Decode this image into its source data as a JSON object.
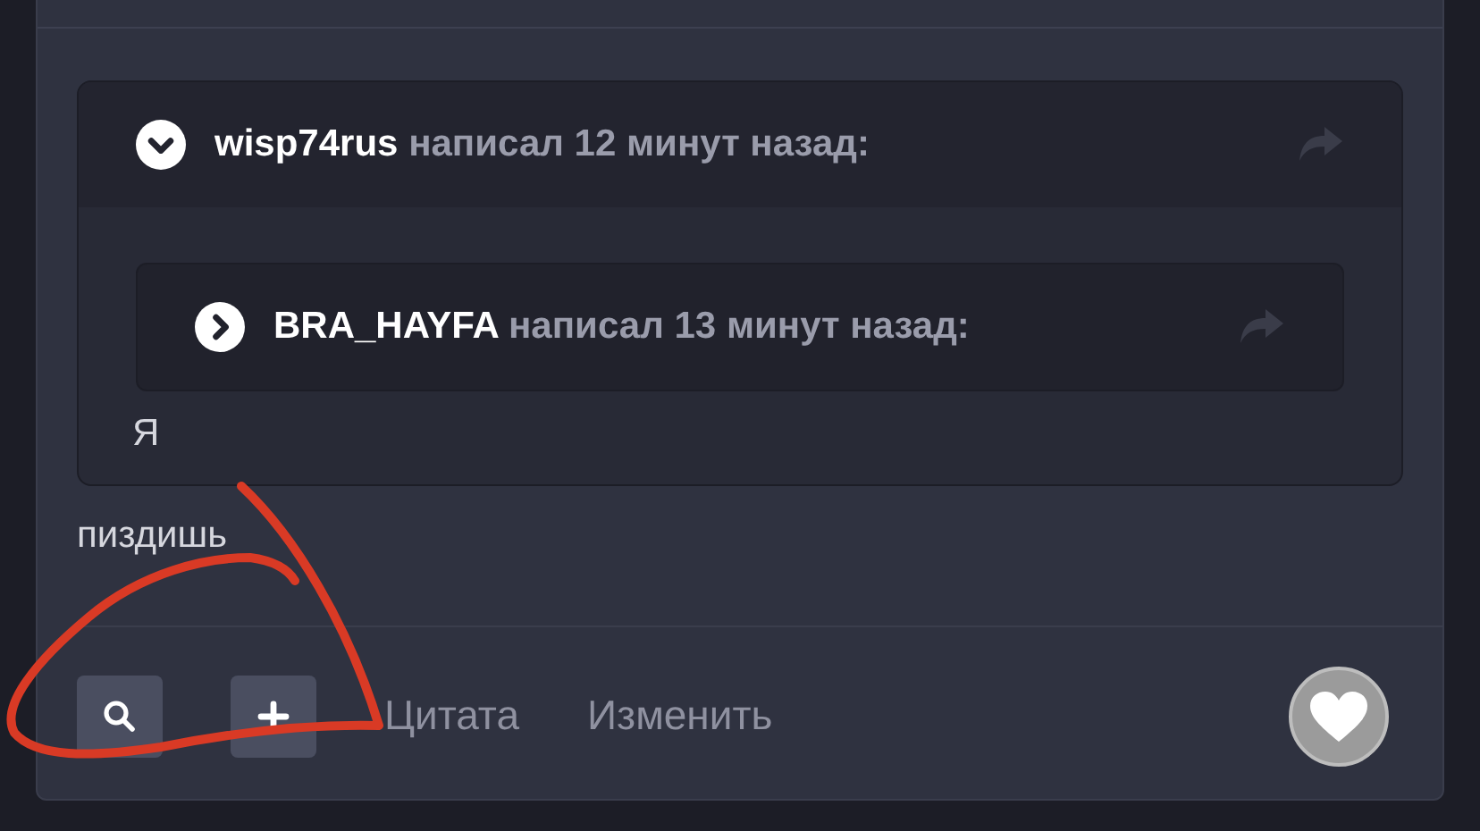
{
  "quote": {
    "author": "wisp74rus",
    "meta": "написал 12 минут назад:",
    "expanded": true,
    "nested": {
      "author": "BRA_HAYFA",
      "meta": "написал 13 минут назад:",
      "expanded": false
    },
    "body": "Я"
  },
  "post_text": "пиздишь",
  "actions": [
    {
      "kind": "search"
    },
    {
      "kind": "add"
    },
    {
      "kind": "link",
      "label": "Цитата"
    },
    {
      "kind": "link",
      "label": "Изменить"
    }
  ]
}
